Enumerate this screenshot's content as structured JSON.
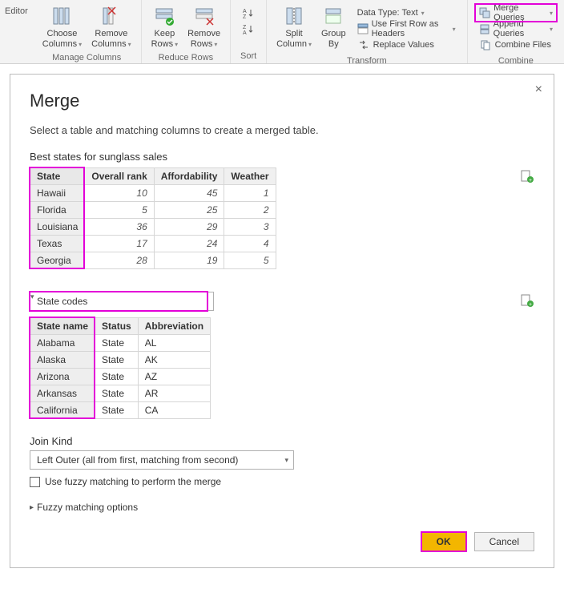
{
  "ribbon": {
    "editor_label": "Editor",
    "manage_columns": {
      "label": "Manage Columns",
      "choose": "Choose\nColumns",
      "remove": "Remove\nColumns"
    },
    "reduce_rows": {
      "label": "Reduce Rows",
      "keep": "Keep\nRows",
      "remove": "Remove\nRows"
    },
    "sort": {
      "label": "Sort"
    },
    "transform": {
      "label": "Transform",
      "split": "Split\nColumn",
      "group": "Group\nBy",
      "datatype": "Data Type: Text",
      "firstrow": "Use First Row as Headers",
      "replace": "Replace Values"
    },
    "combine": {
      "label": "Combine",
      "merge": "Merge Queries",
      "append": "Append Queries",
      "files": "Combine Files"
    }
  },
  "dialog": {
    "title": "Merge",
    "subtitle": "Select a table and matching columns to create a merged table.",
    "table1": {
      "label": "Best states for sunglass sales",
      "headers": [
        "State",
        "Overall rank",
        "Affordability",
        "Weather"
      ],
      "rows": [
        [
          "Hawaii",
          "10",
          "45",
          "1"
        ],
        [
          "Florida",
          "5",
          "25",
          "2"
        ],
        [
          "Louisiana",
          "36",
          "29",
          "3"
        ],
        [
          "Texas",
          "17",
          "24",
          "4"
        ],
        [
          "Georgia",
          "28",
          "19",
          "5"
        ]
      ]
    },
    "table2": {
      "selector": "State codes",
      "headers": [
        "State name",
        "Status",
        "Abbreviation"
      ],
      "rows": [
        [
          "Alabama",
          "State",
          "AL"
        ],
        [
          "Alaska",
          "State",
          "AK"
        ],
        [
          "Arizona",
          "State",
          "AZ"
        ],
        [
          "Arkansas",
          "State",
          "AR"
        ],
        [
          "California",
          "State",
          "CA"
        ]
      ]
    },
    "join_kind_label": "Join Kind",
    "join_kind_value": "Left Outer (all from first, matching from second)",
    "fuzzy_checkbox": "Use fuzzy matching to perform the merge",
    "fuzzy_options": "Fuzzy matching options",
    "ok": "OK",
    "cancel": "Cancel"
  }
}
